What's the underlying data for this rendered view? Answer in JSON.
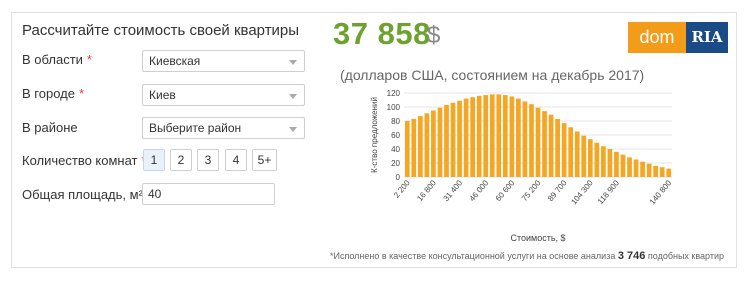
{
  "form": {
    "title": "Рассчитайте стоимость своей квартиры",
    "region_label": "В области",
    "region_value": "Киевская",
    "city_label": "В городе",
    "city_value": "Киев",
    "district_label": "В районе",
    "district_value": "Выберите район",
    "rooms_label": "Количество комнат",
    "rooms_options": [
      "1",
      "2",
      "3",
      "4",
      "5+"
    ],
    "rooms_selected": "1",
    "area_label": "Общая площадь, м²",
    "area_value": "40",
    "required_mark": "*"
  },
  "result": {
    "price": "37 858",
    "currency": "$",
    "subtitle": "(долларов США, состоянием на декабрь 2017)"
  },
  "logo": {
    "left": "dom",
    "right": "RIA"
  },
  "note": {
    "prefix": "*Исполнено в качестве консультационной услуги на основе анализа",
    "count": "3 746",
    "suffix": "подобных квартир"
  },
  "colors": {
    "accent": "#6ea22e",
    "bar": "#f5a623",
    "logo_orange": "#f39c1a",
    "logo_blue": "#1b4b87",
    "required": "#e23b3b"
  },
  "chart_data": {
    "type": "bar",
    "xlabel": "Стоимость, $",
    "ylabel": "К-ство предложений",
    "ylim": [
      0,
      120
    ],
    "yticks": [
      0,
      20,
      40,
      60,
      80,
      100,
      120
    ],
    "xtick_labels": [
      "2 200",
      "16 800",
      "31 400",
      "46 000",
      "60 600",
      "75 200",
      "89 700",
      "104 300",
      "118 900",
      "140 800"
    ],
    "grid": true,
    "values": [
      80,
      83,
      87,
      91,
      95,
      99,
      103,
      106,
      109,
      112,
      114,
      116,
      117,
      118,
      118,
      117,
      115,
      112,
      108,
      104,
      99,
      94,
      89,
      83,
      77,
      71,
      65,
      59,
      54,
      49,
      44,
      40,
      36,
      32,
      28,
      25,
      22,
      19,
      16,
      14,
      12
    ]
  }
}
